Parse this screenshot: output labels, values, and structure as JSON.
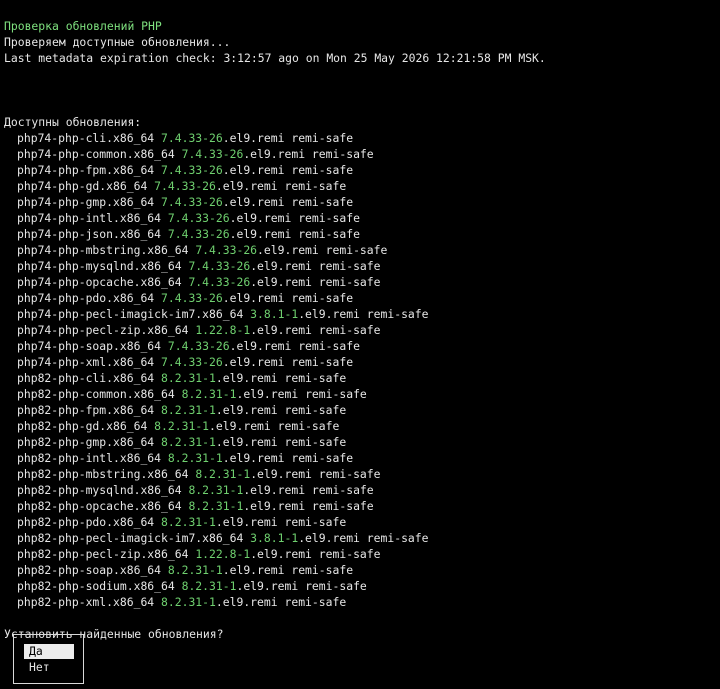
{
  "header": {
    "title": "Проверка обновлений PHP",
    "checking": "Проверяем доступные обновления...",
    "metadata": "Last metadata expiration check: 3:12:57 ago on Mon 25 May 2026 12:21:58 PM MSK."
  },
  "updates": {
    "heading": "Доступны обновления:",
    "packages": [
      {
        "name": "php74-php-cli.x86_64",
        "version": "7.4.33-26",
        "release": ".el9.remi",
        "repo": "remi-safe"
      },
      {
        "name": "php74-php-common.x86_64",
        "version": "7.4.33-26",
        "release": ".el9.remi",
        "repo": "remi-safe"
      },
      {
        "name": "php74-php-fpm.x86_64",
        "version": "7.4.33-26",
        "release": ".el9.remi",
        "repo": "remi-safe"
      },
      {
        "name": "php74-php-gd.x86_64",
        "version": "7.4.33-26",
        "release": ".el9.remi",
        "repo": "remi-safe"
      },
      {
        "name": "php74-php-gmp.x86_64",
        "version": "7.4.33-26",
        "release": ".el9.remi",
        "repo": "remi-safe"
      },
      {
        "name": "php74-php-intl.x86_64",
        "version": "7.4.33-26",
        "release": ".el9.remi",
        "repo": "remi-safe"
      },
      {
        "name": "php74-php-json.x86_64",
        "version": "7.4.33-26",
        "release": ".el9.remi",
        "repo": "remi-safe"
      },
      {
        "name": "php74-php-mbstring.x86_64",
        "version": "7.4.33-26",
        "release": ".el9.remi",
        "repo": "remi-safe"
      },
      {
        "name": "php74-php-mysqlnd.x86_64",
        "version": "7.4.33-26",
        "release": ".el9.remi",
        "repo": "remi-safe"
      },
      {
        "name": "php74-php-opcache.x86_64",
        "version": "7.4.33-26",
        "release": ".el9.remi",
        "repo": "remi-safe"
      },
      {
        "name": "php74-php-pdo.x86_64",
        "version": "7.4.33-26",
        "release": ".el9.remi",
        "repo": "remi-safe"
      },
      {
        "name": "php74-php-pecl-imagick-im7.x86_64",
        "version": "3.8.1-1",
        "release": ".el9.remi",
        "repo": "remi-safe"
      },
      {
        "name": "php74-php-pecl-zip.x86_64",
        "version": "1.22.8-1",
        "release": ".el9.remi",
        "repo": "remi-safe"
      },
      {
        "name": "php74-php-soap.x86_64",
        "version": "7.4.33-26",
        "release": ".el9.remi",
        "repo": "remi-safe"
      },
      {
        "name": "php74-php-xml.x86_64",
        "version": "7.4.33-26",
        "release": ".el9.remi",
        "repo": "remi-safe"
      },
      {
        "name": "php82-php-cli.x86_64",
        "version": "8.2.31-1",
        "release": ".el9.remi",
        "repo": "remi-safe"
      },
      {
        "name": "php82-php-common.x86_64",
        "version": "8.2.31-1",
        "release": ".el9.remi",
        "repo": "remi-safe"
      },
      {
        "name": "php82-php-fpm.x86_64",
        "version": "8.2.31-1",
        "release": ".el9.remi",
        "repo": "remi-safe"
      },
      {
        "name": "php82-php-gd.x86_64",
        "version": "8.2.31-1",
        "release": ".el9.remi",
        "repo": "remi-safe"
      },
      {
        "name": "php82-php-gmp.x86_64",
        "version": "8.2.31-1",
        "release": ".el9.remi",
        "repo": "remi-safe"
      },
      {
        "name": "php82-php-intl.x86_64",
        "version": "8.2.31-1",
        "release": ".el9.remi",
        "repo": "remi-safe"
      },
      {
        "name": "php82-php-mbstring.x86_64",
        "version": "8.2.31-1",
        "release": ".el9.remi",
        "repo": "remi-safe"
      },
      {
        "name": "php82-php-mysqlnd.x86_64",
        "version": "8.2.31-1",
        "release": ".el9.remi",
        "repo": "remi-safe"
      },
      {
        "name": "php82-php-opcache.x86_64",
        "version": "8.2.31-1",
        "release": ".el9.remi",
        "repo": "remi-safe"
      },
      {
        "name": "php82-php-pdo.x86_64",
        "version": "8.2.31-1",
        "release": ".el9.remi",
        "repo": "remi-safe"
      },
      {
        "name": "php82-php-pecl-imagick-im7.x86_64",
        "version": "3.8.1-1",
        "release": ".el9.remi",
        "repo": "remi-safe"
      },
      {
        "name": "php82-php-pecl-zip.x86_64",
        "version": "1.22.8-1",
        "release": ".el9.remi",
        "repo": "remi-safe"
      },
      {
        "name": "php82-php-soap.x86_64",
        "version": "8.2.31-1",
        "release": ".el9.remi",
        "repo": "remi-safe"
      },
      {
        "name": "php82-php-sodium.x86_64",
        "version": "8.2.31-1",
        "release": ".el9.remi",
        "repo": "remi-safe"
      },
      {
        "name": "php82-php-xml.x86_64",
        "version": "8.2.31-1",
        "release": ".el9.remi",
        "repo": "remi-safe"
      }
    ]
  },
  "prompt": {
    "question": "Установить найденные обновления?",
    "options": [
      {
        "label": "Да",
        "selected": true
      },
      {
        "label": "Нет",
        "selected": false
      }
    ]
  },
  "colors": {
    "background": "#000000",
    "text": "#e6e6e6",
    "title": "#7ee07e",
    "version": "#6fd06f",
    "selection": "#ececec"
  }
}
